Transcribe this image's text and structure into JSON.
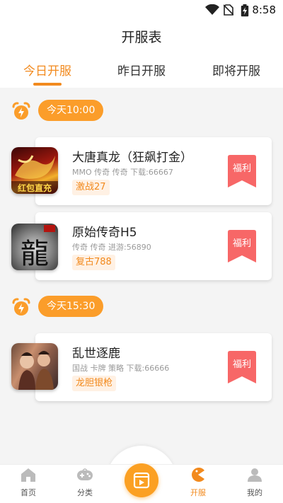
{
  "status_bar": {
    "time": "8:58",
    "icons": [
      "wifi-icon",
      "no-sim-icon",
      "battery-icon"
    ]
  },
  "header": {
    "title": "开服表"
  },
  "tabs": [
    {
      "label": "今日开服",
      "active": true
    },
    {
      "label": "昨日开服",
      "active": false
    },
    {
      "label": "即将开服",
      "active": false
    }
  ],
  "sections": [
    {
      "time": "今天10:00",
      "games": [
        {
          "name": "大唐真龙（狂飙打金）",
          "meta": "MMO 传奇 传奇 下载:66667",
          "tag": "激战27",
          "badge": "福利",
          "thumb_text": "红包直充"
        },
        {
          "name": "原始传奇H5",
          "meta": "传奇 传奇 进游:56890",
          "tag": "复古788",
          "badge": "福利",
          "thumb_text": "龍"
        }
      ]
    },
    {
      "time": "今天15:30",
      "games": [
        {
          "name": "乱世逐鹿",
          "meta": "国战 卡牌 策略 下载:66666",
          "tag": "龙胆银枪",
          "badge": "福利",
          "thumb_text": ""
        }
      ]
    }
  ],
  "bottom_nav": [
    {
      "label": "首页",
      "icon": "home-icon"
    },
    {
      "label": "分类",
      "icon": "gamepad-icon"
    },
    {
      "label": "",
      "icon": "video-icon"
    },
    {
      "label": "开服",
      "icon": "pacman-icon",
      "active": true
    },
    {
      "label": "我的",
      "icon": "user-icon"
    }
  ],
  "colors": {
    "accent": "#f28a1e",
    "pill": "#fb9d2a",
    "badge": "#f76767",
    "tag_bg": "#fff1e4"
  }
}
